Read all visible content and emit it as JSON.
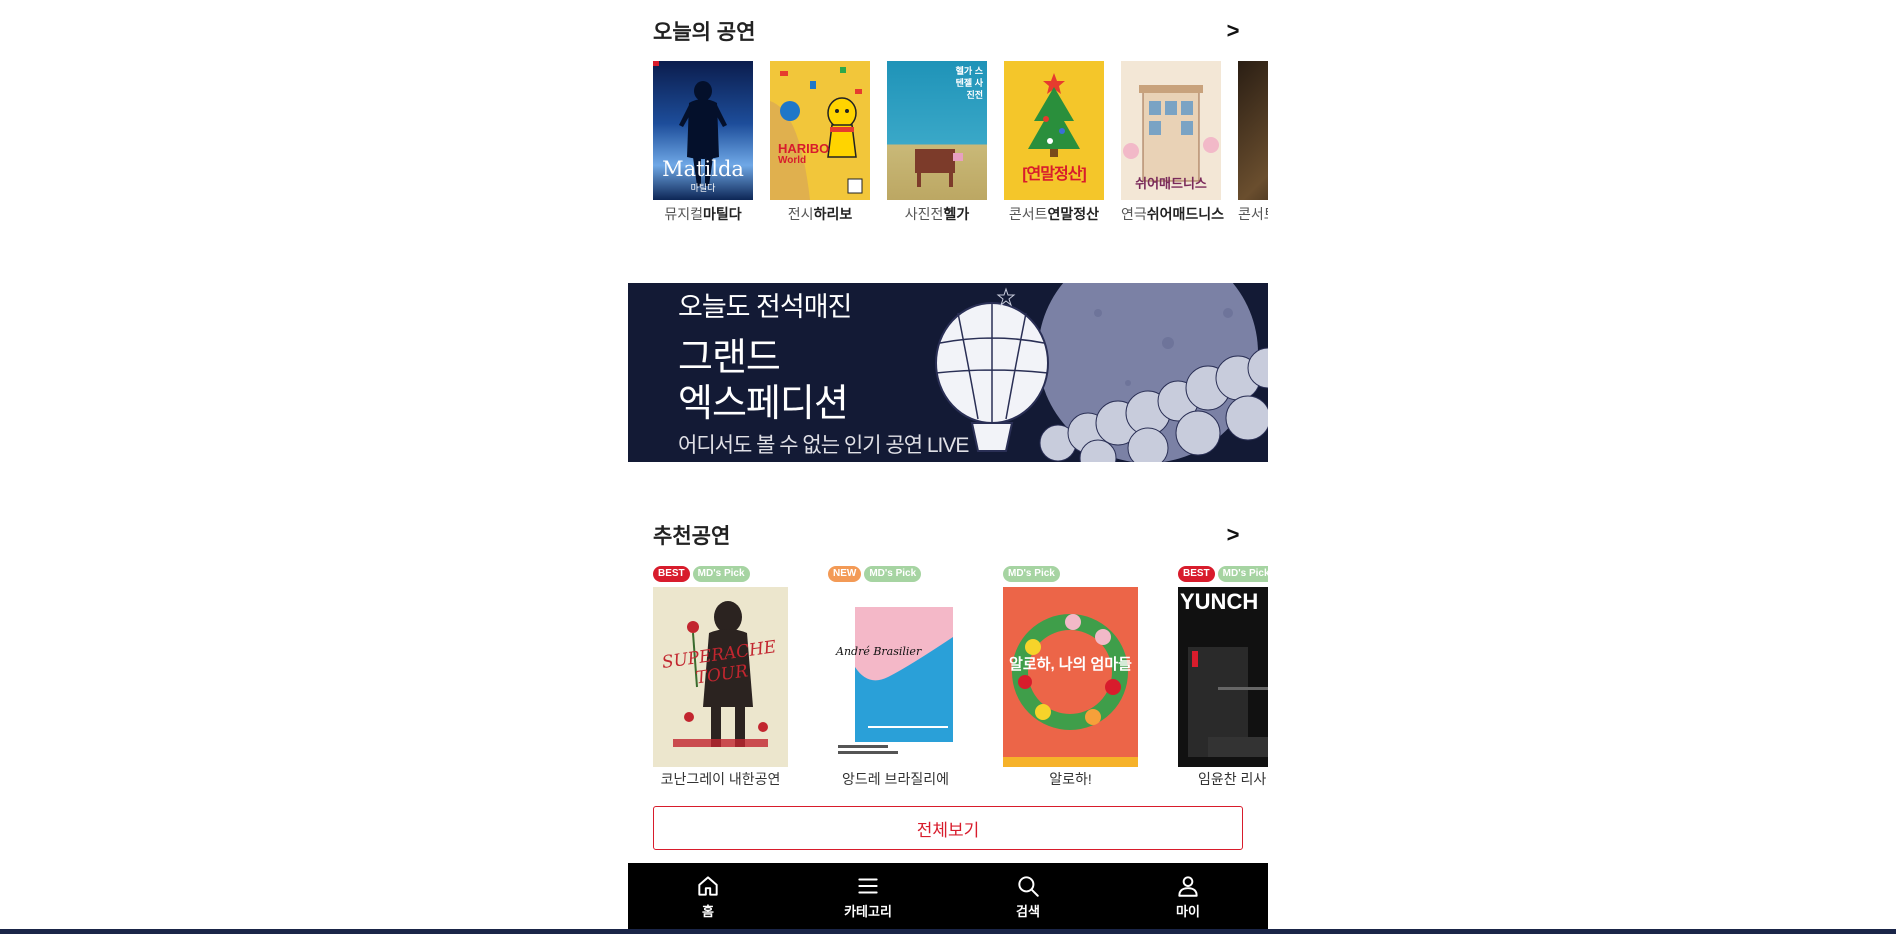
{
  "today": {
    "title": "오늘의 공연",
    "more": ">",
    "items": [
      {
        "genre": "뮤지컬",
        "name": "마틸다",
        "poster_text": "Matilda",
        "poster_sub": "마틸다"
      },
      {
        "genre": "전시",
        "name": "하리보",
        "poster_text": "HARIBO",
        "poster_sub": "World"
      },
      {
        "genre": "사진전",
        "name": "헬가",
        "poster_text": "헬가 스텐젤 사진전",
        "poster_sub": ""
      },
      {
        "genre": "콘서트",
        "name": "연말정산",
        "poster_text": "[연말정산]",
        "poster_sub": ""
      },
      {
        "genre": "연극",
        "name": "쉬어매드니스",
        "poster_text": "쉬어매드니스",
        "poster_sub": ""
      },
      {
        "genre": "콘서트",
        "name": "",
        "poster_text": "",
        "poster_sub": ""
      }
    ]
  },
  "banner": {
    "line1": "오늘도 전석매진",
    "line2a": "그랜드",
    "line2b": "엑스페디션",
    "line3": "어디서도 볼 수 없는 인기 공연 LIVE"
  },
  "recommended": {
    "title": "추천공연",
    "more": ">",
    "items": [
      {
        "badges": [
          "BEST",
          "MD's Pick"
        ],
        "name": "코난그레이 내한공연",
        "poster_text": "SUPERACHE TOUR"
      },
      {
        "badges": [
          "NEW",
          "MD's Pick"
        ],
        "name": "앙드레 브라질리에",
        "poster_text": "André Brasilier"
      },
      {
        "badges": [
          "MD's Pick"
        ],
        "name": "알로하!",
        "poster_text": "알로하, 나의 엄마들"
      },
      {
        "badges": [
          "BEST",
          "MD's Pick"
        ],
        "name": "임윤찬 리사",
        "poster_text": "YUNCH"
      }
    ],
    "view_all": "전체보기"
  },
  "tabbar": {
    "items": [
      {
        "label": "홈",
        "icon": "home-icon"
      },
      {
        "label": "카테고리",
        "icon": "menu-icon"
      },
      {
        "label": "검색",
        "icon": "search-icon"
      },
      {
        "label": "마이",
        "icon": "user-icon"
      }
    ]
  },
  "colors": {
    "best": "#d81c2c",
    "new": "#f39a56",
    "mdpick": "#a6d4a2",
    "banner_bg": "#131a35",
    "accent": "#d81c2c",
    "tabbar_bg": "#000000"
  }
}
